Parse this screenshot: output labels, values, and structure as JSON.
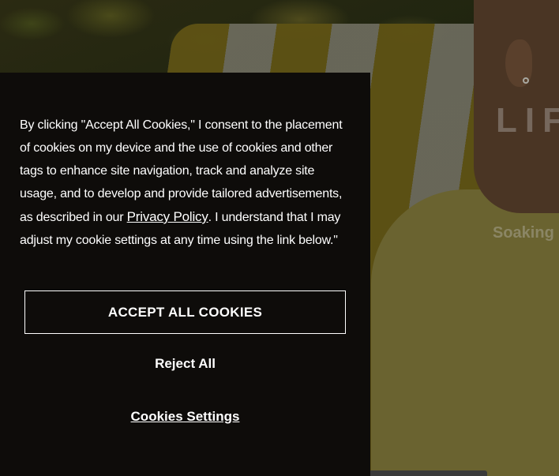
{
  "hero": {
    "title": "LIF",
    "subtitle": "Soaking"
  },
  "consent": {
    "text_before_link": "By clicking \"Accept All Cookies,\" I consent to the placement of cookies on my device and the use of cookies and other tags to enhance site navigation, track and analyze site usage, and to develop and provide tailored advertisements, as described in our ",
    "privacy_link": "Privacy Policy",
    "text_after_link": ". I understand that I may adjust my cookie settings at any time using the link below.\"",
    "accept_label": "ACCEPT ALL COOKIES",
    "reject_label": "Reject All",
    "settings_label": "Cookies Settings"
  },
  "colors": {
    "panel_background": "#0e0c0a",
    "panel_text": "#ffffff",
    "hero_accent": "#5e5214"
  }
}
